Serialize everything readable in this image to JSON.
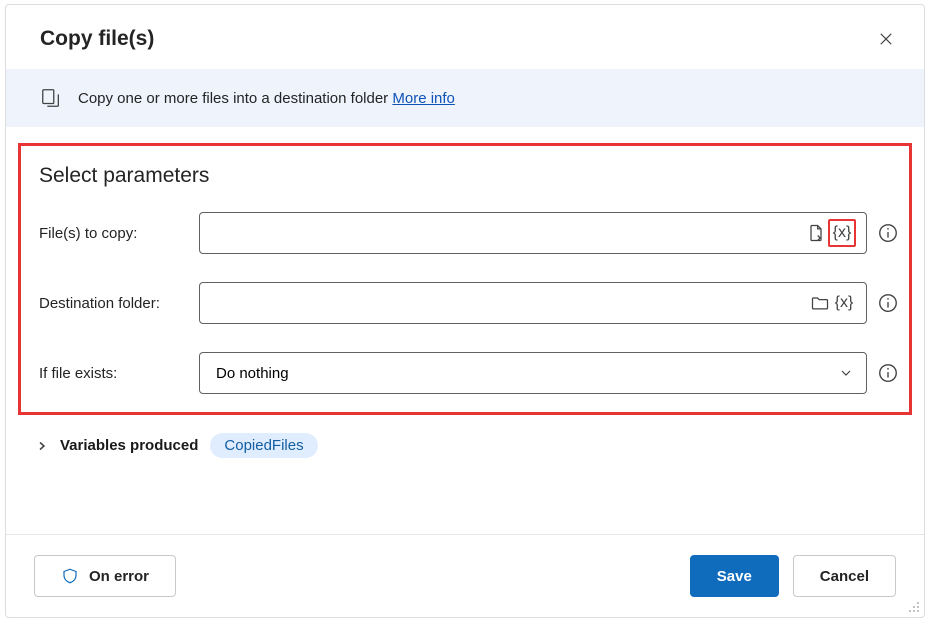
{
  "dialog": {
    "title": "Copy file(s)"
  },
  "banner": {
    "text": "Copy one or more files into a destination folder",
    "link": "More info"
  },
  "section": {
    "title": "Select parameters"
  },
  "fields": {
    "files_label": "File(s) to copy:",
    "files_value": "",
    "dest_label": "Destination folder:",
    "dest_value": "",
    "exists_label": "If file exists:",
    "exists_value": "Do nothing"
  },
  "variables": {
    "label": "Variables produced",
    "chip": "CopiedFiles"
  },
  "footer": {
    "onerror": "On error",
    "save": "Save",
    "cancel": "Cancel"
  }
}
